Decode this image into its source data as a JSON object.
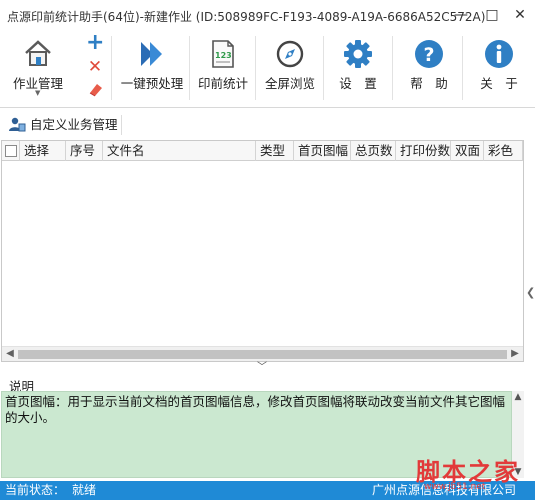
{
  "window": {
    "title": "点源印前统计助手(64位)-新建作业 (ID:508989FC-F193-4089-A19A-6686A52C572A)",
    "minimize": "—",
    "maximize": "□",
    "close": "✕"
  },
  "ribbon": {
    "job_manage": "作业管理",
    "add": "+",
    "remove": "✕",
    "one_click": "一键预处理",
    "print_stat": "印前统计",
    "fullscreen": "全屏浏览",
    "settings": "设　置",
    "help": "帮　助",
    "about": "关　于"
  },
  "subbar": {
    "custom_business": "自定义业务管理"
  },
  "grid": {
    "columns": [
      "选择",
      "序号",
      "文件名",
      "类型",
      "首页图幅",
      "总页数",
      "打印份数",
      "双面",
      "彩色"
    ],
    "rows": []
  },
  "desc": {
    "title": "说明",
    "body": "首页图幅：用于显示当前文档的首页图幅信息，修改首页图幅将联动改变当前文件其它图幅的大小。"
  },
  "status": {
    "label": "当前状态：",
    "value": "就绪",
    "company": "广州点源信息科技有限公司"
  },
  "watermark": {
    "text": "脚本之家",
    "url": "www.jb51.net"
  },
  "colors": {
    "status_bar": "#1f8ad6",
    "desc_bg": "#cbe8d0",
    "accent_blue": "#2f7fc4"
  },
  "icons": {
    "job_manage": "house-icon",
    "one_click": "double-chevron-icon",
    "print_stat": "document-123-icon",
    "fullscreen": "compass-icon",
    "settings": "gear-icon",
    "help": "question-icon",
    "about": "info-icon"
  }
}
